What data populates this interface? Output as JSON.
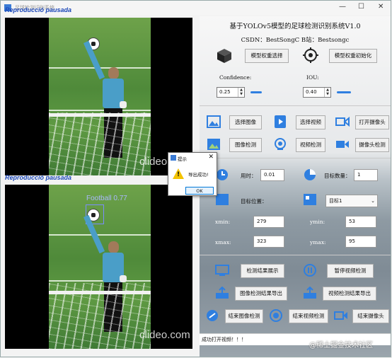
{
  "window": {
    "title": "足球检测识别系统",
    "watermark_top": "Reproducció pausada",
    "watermark_bottom": "Reproducció pausada",
    "minimize": "—",
    "maximize": "☐",
    "close": "✕"
  },
  "video_top": {
    "watermark": "clideo.com"
  },
  "video_bottom": {
    "watermark": "clideo.com",
    "detection_label": "Football  0.77"
  },
  "header": {
    "title": "基于YOLOv5模型的足球检测识别系统V1.0",
    "csdn": "CSDN：BestSongC   B站：Bestsongc"
  },
  "model": {
    "select_label": "模型权重选择",
    "init_label": "模型权重初始化"
  },
  "params": {
    "confidence_label": "Confidence:",
    "confidence_value": "0.25",
    "iou_label": "IOU:",
    "iou_value": "0.40"
  },
  "sources": {
    "select_image": "选择图像",
    "select_video": "选择视频",
    "open_camera": "打开摄像头",
    "image_detect": "图像检测",
    "video_detect": "视频检测",
    "camera_detect": "摄像头检测"
  },
  "results": {
    "time_label": "用时：",
    "time_value": "0.01",
    "count_label": "目标数量：",
    "count_value": "1",
    "position_label": "目标位置：",
    "target_select": "目标1",
    "xmin_label": "xmin:",
    "xmin_value": "279",
    "ymin_label": "ymin:",
    "ymin_value": "53",
    "xmax_label": "xmax:",
    "xmax_value": "323",
    "ymax_label": "ymax:",
    "ymax_value": "95"
  },
  "actions": {
    "show_result": "检测结果展示",
    "pause_video": "暂停视频检测",
    "export_image": "图像检测结果导出",
    "export_video": "视频检测结果导出",
    "end_image": "结束图像检测",
    "end_video": "结束视频检测",
    "end_camera": "结束摄像头"
  },
  "status": {
    "text": "成功打开视频！！！"
  },
  "corner_watermark": "@稀土掘金技术社区",
  "dialog": {
    "title": "提示",
    "close": "✕",
    "message": "导出成功!",
    "ok": "OK"
  },
  "colors": {
    "accent": "#2f7fe0",
    "detection_box": "#7a8cff",
    "warning": "#f3c300"
  }
}
